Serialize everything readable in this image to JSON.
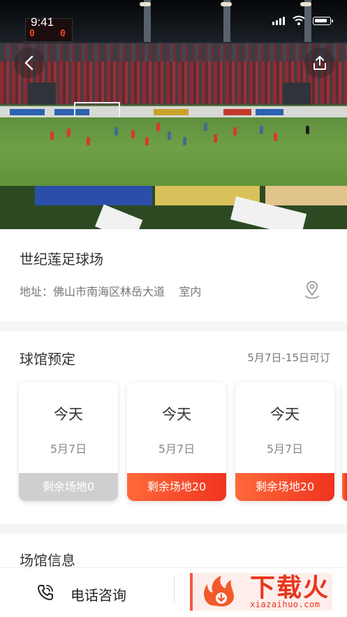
{
  "status_bar": {
    "time": "9:41"
  },
  "hero": {
    "scoreboard": {
      "home": "0",
      "away": "0"
    }
  },
  "venue": {
    "name": "世纪莲足球场",
    "address_label": "地址：",
    "address": "佛山市南海区林岳大道",
    "type": "室内"
  },
  "booking": {
    "title": "球馆预定",
    "range": "5月7日-15日可订",
    "days": [
      {
        "day": "今天",
        "date": "5月7日",
        "availability": "剩余场地0",
        "status": "full"
      },
      {
        "day": "今天",
        "date": "5月7日",
        "availability": "剩余场地20",
        "status": "open"
      },
      {
        "day": "今天",
        "date": "5月7日",
        "availability": "剩余场地20",
        "status": "open"
      }
    ]
  },
  "info": {
    "title": "场馆信息"
  },
  "bottom_bar": {
    "phone_label": "电话咨询"
  },
  "watermark": {
    "brand": "下载火",
    "url": "xiazaihuo.com"
  },
  "colors": {
    "accent": "#f0331f",
    "sold_out": "#cfcfcf",
    "text": "#333333",
    "subtext": "#777777"
  },
  "icons": [
    "back-arrow-icon",
    "share-icon",
    "location-pin-icon",
    "phone-icon",
    "signal-icon",
    "wifi-icon",
    "battery-icon"
  ]
}
